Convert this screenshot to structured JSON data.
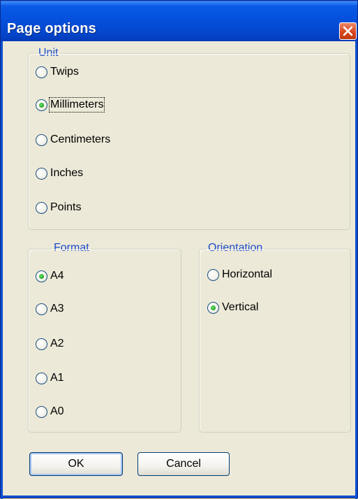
{
  "window": {
    "title": "Page options"
  },
  "unit_group": {
    "legend": "Unit",
    "options": [
      {
        "label": "Twips",
        "checked": false
      },
      {
        "label": "Millimeters",
        "checked": true
      },
      {
        "label": "Centimeters",
        "checked": false
      },
      {
        "label": "Inches",
        "checked": false
      },
      {
        "label": "Points",
        "checked": false
      }
    ]
  },
  "format_group": {
    "legend": "Format",
    "options": [
      {
        "label": "A4",
        "checked": true
      },
      {
        "label": "A3",
        "checked": false
      },
      {
        "label": "A2",
        "checked": false
      },
      {
        "label": "A1",
        "checked": false
      },
      {
        "label": "A0",
        "checked": false
      }
    ]
  },
  "orientation_group": {
    "legend": "Orientation",
    "options": [
      {
        "label": "Horizontal",
        "checked": false
      },
      {
        "label": "Vertical",
        "checked": true
      }
    ]
  },
  "buttons": {
    "ok_label": "OK",
    "cancel_label": "Cancel"
  },
  "colors": {
    "title_bar": "#0550dc",
    "legend_text": "#1c4cc8",
    "dialog_bg": "#ece9d8",
    "close_button": "#d9461f"
  }
}
